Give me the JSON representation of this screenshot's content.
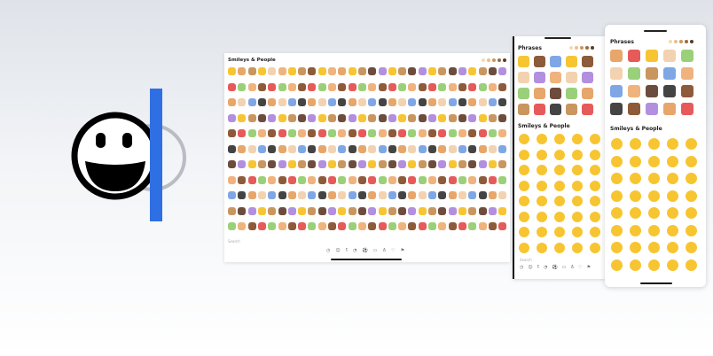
{
  "tablet": {
    "section_title": "Smileys & People",
    "search_placeholder": "Search",
    "category_icons": [
      "clock-icon",
      "smiley-icon",
      "bear-icon",
      "food-icon",
      "ball-icon",
      "car-icon",
      "bulb-icon",
      "symbols-icon",
      "flag-icon"
    ],
    "rows": 11,
    "cols": 28
  },
  "phone_small": {
    "phrases_title": "Phrases",
    "smileys_title": "Smileys & People",
    "search_placeholder": "Search"
  },
  "phone_large": {
    "phrases_title": "Phrases",
    "smileys_title": "Smileys & People"
  },
  "colors": {
    "accent": "#2f6fe4",
    "smiley_yellow": "#f7c531",
    "skin_tones": [
      "#f6d9b0",
      "#e9bf8c",
      "#c9965f",
      "#9a6a3f",
      "#5a3b24"
    ]
  }
}
